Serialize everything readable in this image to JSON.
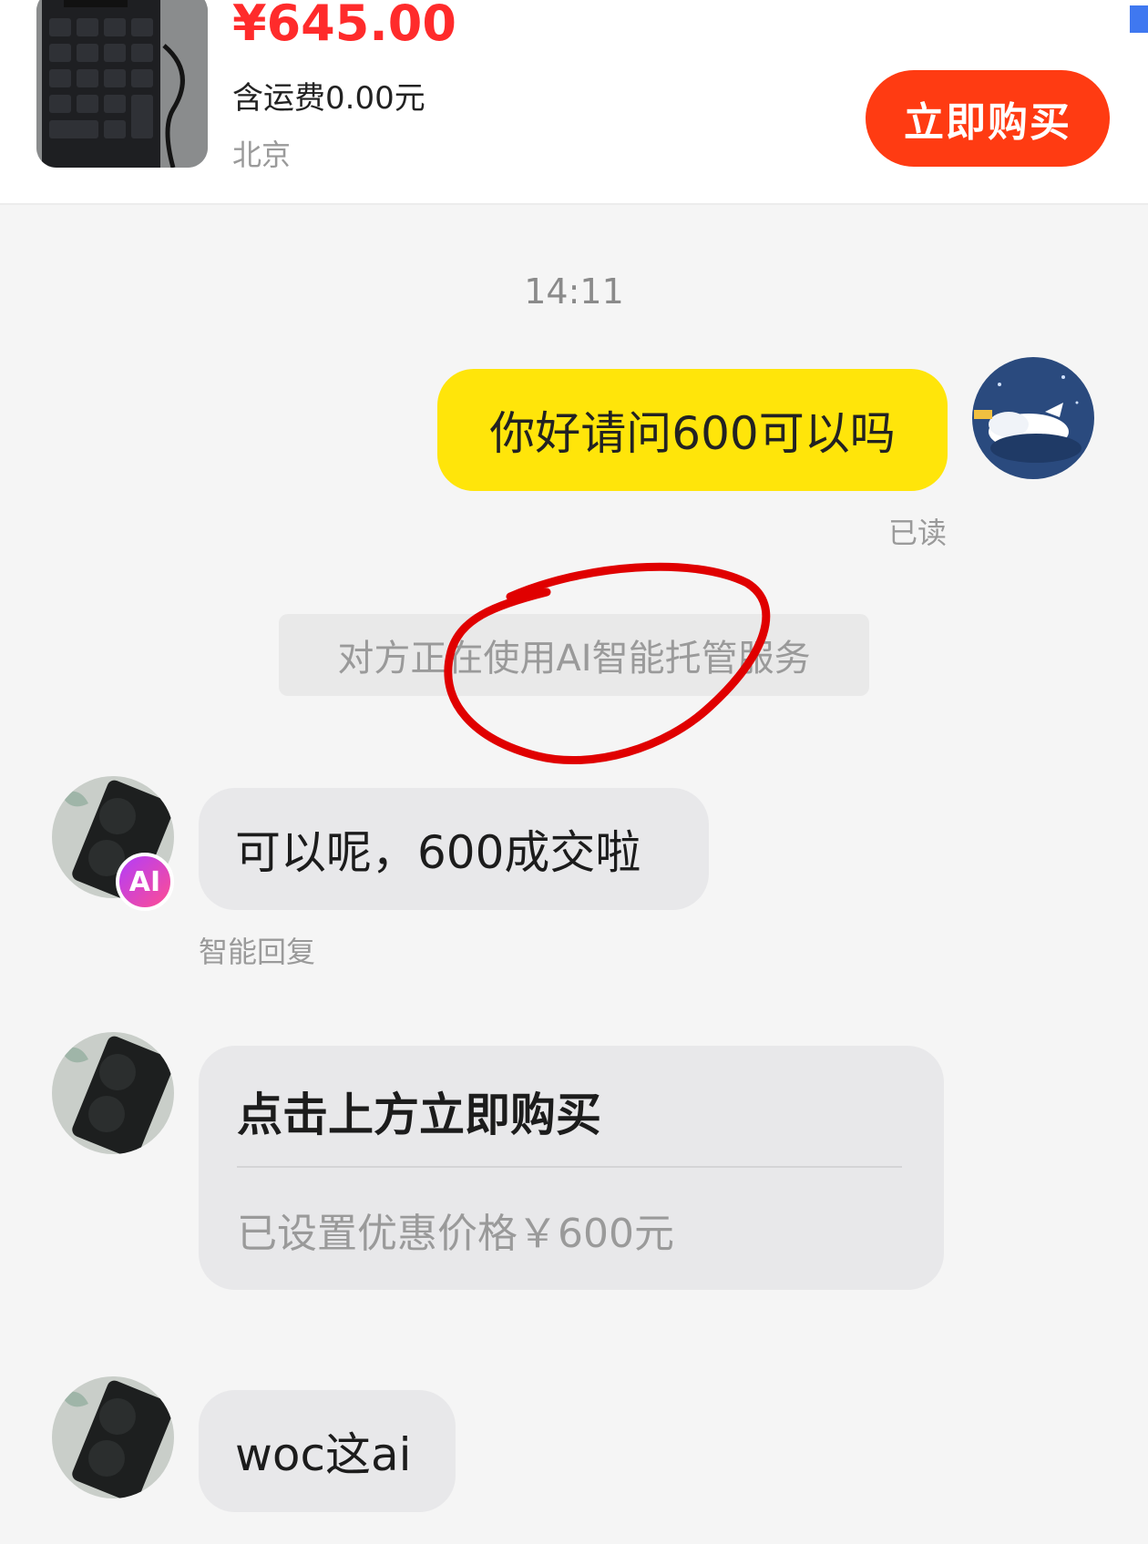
{
  "product": {
    "price": "¥645.00",
    "shipping": "含运费0.00元",
    "location": "北京",
    "buy_label": "立即购买",
    "thumbnail": "keyboard-photo"
  },
  "chat": {
    "timestamp": "14:11",
    "my_message": "你好请问600可以吗",
    "read_status": "已读",
    "system_notice": "对方正在使用AI智能托管服务",
    "ai_badge": "AI",
    "reply_1": "可以呢，600成交啦",
    "reply_1_label": "智能回复",
    "card_title": "点击上方立即购买",
    "card_subtitle": "已设置优惠价格￥600元",
    "reply_3": "woc这ai"
  },
  "colors": {
    "price": "#ff2b2b",
    "buy_button": "#ff3b12",
    "my_bubble": "#ffe50a",
    "other_bubble": "#e8e8ea",
    "annotation": "#e00000"
  }
}
